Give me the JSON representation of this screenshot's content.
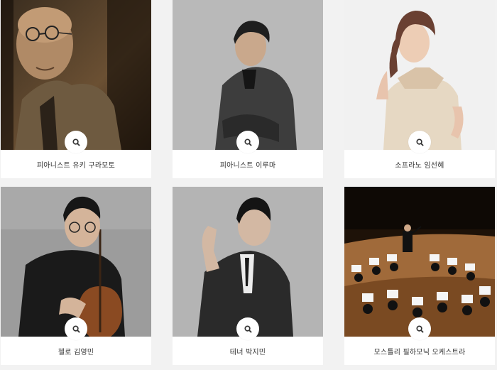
{
  "colors": {
    "page_bg": "#f2f2f2",
    "card_bg": "#ffffff",
    "caption_text": "#333333"
  },
  "icons": {
    "zoom": "search-icon"
  },
  "artists": [
    {
      "name": "피아니스트 유키 구라모토",
      "photo": "yuki-kuramoto-portrait"
    },
    {
      "name": "피아니스트 이루마",
      "photo": "yiruma-portrait"
    },
    {
      "name": "소프라노 임선혜",
      "photo": "sunhae-im-portrait"
    },
    {
      "name": "첼로 김영민",
      "photo": "cellist-portrait"
    },
    {
      "name": "테너 박지민",
      "photo": "tenor-portrait"
    },
    {
      "name": "모스틀리 필하모닉 오케스트라",
      "photo": "orchestra-stage"
    }
  ]
}
